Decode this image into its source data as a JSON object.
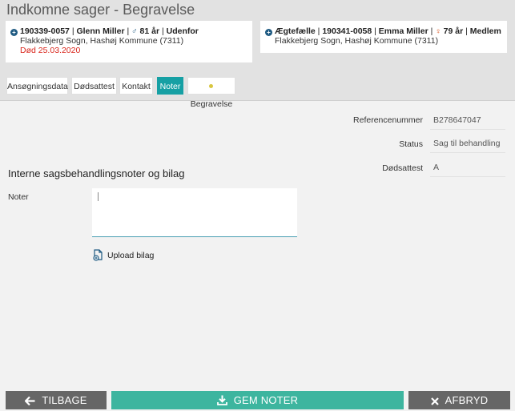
{
  "page": {
    "title": "Indkomne sager - Begravelse"
  },
  "deceased": {
    "cpr": "190339-0057",
    "name": "Glenn Miller",
    "age": "81 år",
    "location": "Udenfor",
    "parish": "Flakkebjerg Sogn, Hashøj Kommune (7311)",
    "death": "Død 25.03.2020"
  },
  "spouse": {
    "relation": "Ægtefælle",
    "cpr": "190341-0058",
    "name": "Emma Miller",
    "age": "79 år",
    "membership": "Medlem",
    "parish": "Flakkebjerg Sogn, Hashøj Kommune (7311)"
  },
  "tabs": [
    {
      "label": "Ansøgningsdata"
    },
    {
      "label": "Dødsattest"
    },
    {
      "label": "Kontakt"
    },
    {
      "label": "Noter",
      "active": true
    },
    {
      "label": "Begravelse"
    }
  ],
  "info": {
    "reference_label": "Referencenummer",
    "reference_value": "B278647047",
    "status_label": "Status",
    "status_value": "Sag til behandling",
    "certificate_label": "Dødsattest",
    "certificate_value": "A"
  },
  "notes": {
    "section_title": "Interne sagsbehandlingsnoter og bilag",
    "label": "Noter",
    "value": "",
    "upload_label": "Upload bilag"
  },
  "footer": {
    "back_label": "TILBAGE",
    "save_label": "GEM NOTER",
    "cancel_label": "AFBRYD"
  },
  "colors": {
    "accent": "#16a0a4",
    "save": "#3db59f",
    "dark_button": "#666666",
    "death_red": "#d9261c"
  }
}
